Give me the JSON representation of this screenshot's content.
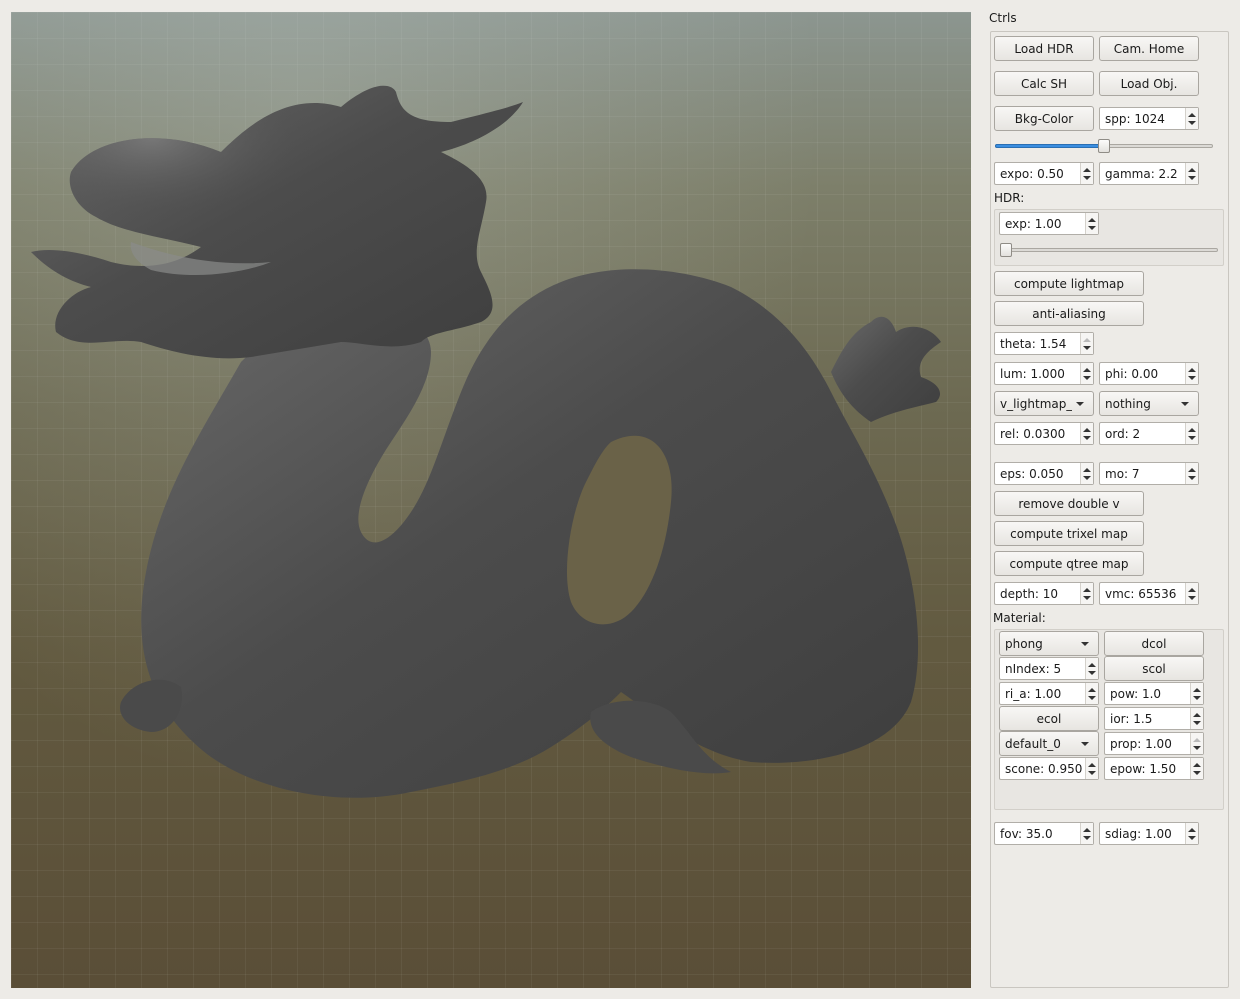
{
  "panel": {
    "title": "Ctrls"
  },
  "buttons": {
    "load_hdr": "Load HDR",
    "cam_home": "Cam. Home",
    "calc_sh": "Calc SH",
    "load_obj": "Load Obj.",
    "bkg_color": "Bkg-Color",
    "compute_lightmap": "compute lightmap",
    "anti_aliasing": "anti-aliasing",
    "remove_double_v": "remove double v",
    "compute_trixel_map": "compute trixel map",
    "compute_qtree_map": "compute qtree map"
  },
  "fields": {
    "spp": "spp: 1024",
    "expo": "expo: 0.50",
    "gamma": "gamma: 2.2",
    "theta": "theta: 1.54",
    "lum": "lum: 1.000",
    "phi": "phi: 0.00",
    "rel": "rel: 0.0300",
    "ord": "ord: 2",
    "eps": "eps: 0.050",
    "mo": "mo: 7",
    "depth": "depth: 10",
    "vmc": "vmc: 65536",
    "fov": "fov: 35.0",
    "sdiag": "sdiag: 1.00"
  },
  "spp_slider": {
    "fraction": 0.5
  },
  "hdr": {
    "label": "HDR:",
    "exp": "exp: 1.00",
    "slider_fraction": 0.0
  },
  "selects": {
    "v_lightmap": "v_lightmap_s",
    "nothing": "nothing"
  },
  "material": {
    "label": "Material:",
    "shading": "phong",
    "dcol": "dcol",
    "nindex": "nIndex: 5",
    "scol": "scol",
    "ri_a": "ri_a: 1.00",
    "pow": "pow: 1.0",
    "ecol": "ecol",
    "ior": "ior: 1.5",
    "preset": "default_0",
    "prop": "prop: 1.00",
    "scone": "scone: 0.950",
    "epow": "epow: 1.50"
  },
  "viewport": {
    "background_top": "#8c9690",
    "background_bottom": "#5a4e37",
    "model_color": "#4a4a4a"
  },
  "accent": "#3b8ee0"
}
